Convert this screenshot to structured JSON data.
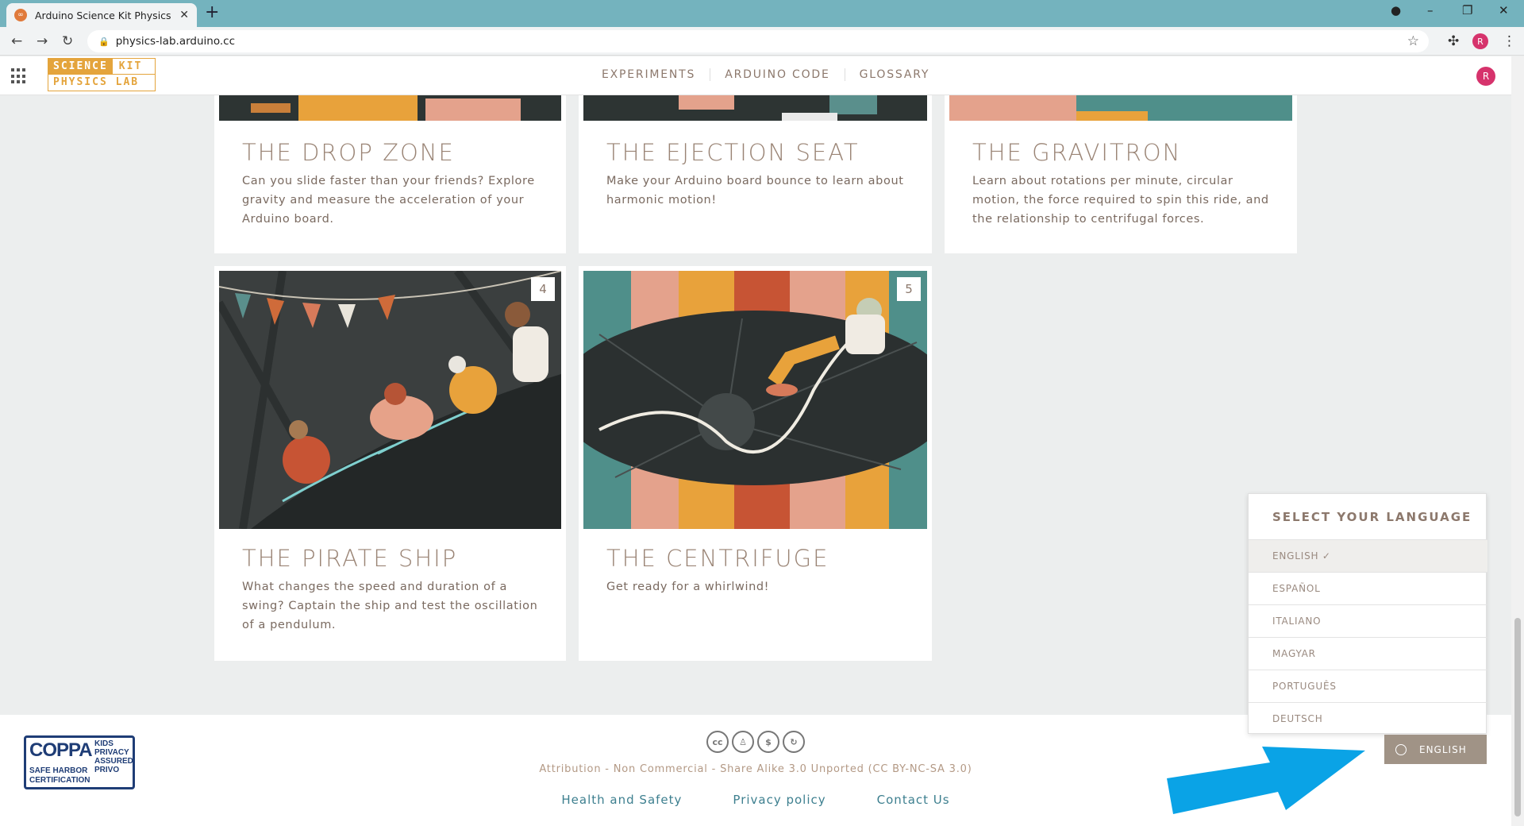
{
  "browser": {
    "tab_title": "Arduino Science Kit Physics Lab",
    "url": "physics-lab.arduino.cc",
    "profile_initial": "R"
  },
  "header": {
    "logo_line1_a": "SCIENCE",
    "logo_line1_b": "KIT",
    "logo_line2": "PHYSICS LAB",
    "nav": [
      "EXPERIMENTS",
      "ARDUINO CODE",
      "GLOSSARY"
    ],
    "user_initial": "R"
  },
  "cards": [
    {
      "title": "THE DROP ZONE",
      "desc": "Can you slide faster than your friends? Explore gravity and measure the acceleration of your Arduino board."
    },
    {
      "title": "THE EJECTION SEAT",
      "desc": "Make your Arduino board bounce to learn about harmonic motion!"
    },
    {
      "title": "THE GRAVITRON",
      "desc": "Learn about rotations per minute, circular motion, the force required to spin this ride, and the relationship to centrifugal forces."
    },
    {
      "number": "4",
      "title": "THE PIRATE SHIP",
      "desc": "What changes the speed and duration of a swing? Captain the ship and test the oscillation of a pendulum."
    },
    {
      "number": "5",
      "title": "THE CENTRIFUGE",
      "desc": "Get ready for a whirlwind!"
    }
  ],
  "footer": {
    "coppa_big": "COPPA",
    "coppa_small": "SAFE HARBOR CERTIFICATION",
    "coppa_right": "KIDS PRIVACY ASSURED PRIVO",
    "cc_icons": [
      "cc",
      "by",
      "nc",
      "sa"
    ],
    "license": "Attribution - Non Commercial - Share Alike 3.0 Unported (CC BY-NC-SA 3.0)",
    "links": [
      "Health and Safety",
      "Privacy policy",
      "Contact Us"
    ]
  },
  "language": {
    "heading": "SELECT YOUR LANGUAGE",
    "options": [
      "ENGLISH ✓",
      "ESPAÑOL",
      "ITALIANO",
      "MAGYAR",
      "PORTUGUÊS",
      "DEUTSCH"
    ],
    "selected_index": 0,
    "button_label": "ENGLISH"
  },
  "colors": {
    "accent": "#e4a43c",
    "arrow": "#0aa3e6",
    "link": "#3d7f8f"
  }
}
